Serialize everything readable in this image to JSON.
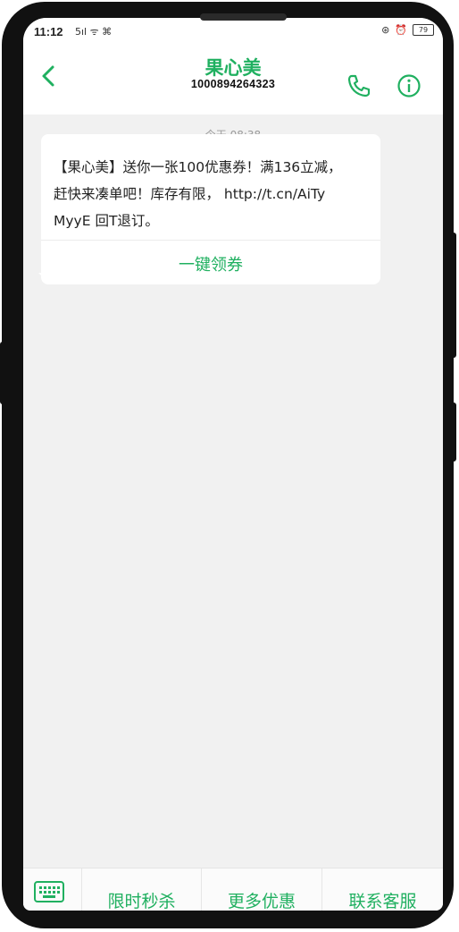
{
  "status_bar": {
    "time": "11:12",
    "left_indicators": "5ıl ᯤ ⌘",
    "battery": "79"
  },
  "header": {
    "title": "果心美",
    "number": "1000894264323"
  },
  "conversation": {
    "timestamp": "今天 08:38",
    "message": {
      "text": "【果心美】送你一张100优惠券！满136立减，\n赶快来凑单吧！库存有限， http://t.cn/AiTy\nMyyE 回T退订。",
      "action_label": "一键领券"
    }
  },
  "bottom_menu": {
    "items": [
      "限时秒杀",
      "更多优惠",
      "联系客服"
    ]
  },
  "colors": {
    "accent": "#20b060",
    "background": "#f1f1f1",
    "frame": "#111111"
  }
}
